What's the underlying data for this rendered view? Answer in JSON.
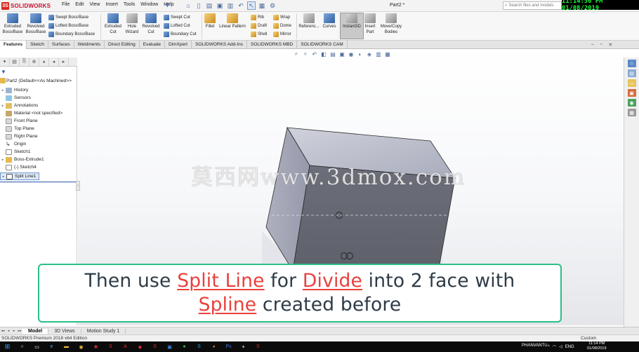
{
  "app": {
    "logo_text": "SOLIDWORKS",
    "document_title": "Part2 *",
    "search_placeholder": "Search files and models",
    "recording_clock": "11:14:56 PM 01/08/2019"
  },
  "menu": [
    "File",
    "Edit",
    "View",
    "Insert",
    "Tools",
    "Window",
    "Help"
  ],
  "quick_access": [
    "home-icon",
    "new-icon",
    "open-icon",
    "save-icon",
    "print-icon",
    "undo-icon",
    "select-icon",
    "rebuild-icon",
    "options-icon"
  ],
  "command_manager": {
    "extruded_boss": "Extruded Boss/Base",
    "revolved_boss": "Revolved Boss/Base",
    "swept_boss": "Swept Boss/Base",
    "lofted_boss": "Lofted Boss/Base",
    "boundary_boss": "Boundary Boss/Base",
    "extruded_cut": "Extruded Cut",
    "hole_wizard": "Hole Wizard",
    "revolved_cut": "Revolved Cut",
    "swept_cut": "Swept Cut",
    "lofted_cut": "Lofted Cut",
    "boundary_cut": "Boundary Cut",
    "fillet": "Fillet",
    "linear_pattern": "Linear Pattern",
    "rib": "Rib",
    "draft": "Draft",
    "shell": "Shell",
    "wrap": "Wrap",
    "dome": "Dome",
    "mirror": "Mirror",
    "reference_geometry": "Referenc...",
    "curves": "Curves",
    "instant3d": "Instant3D",
    "insert_part": "Insert Part",
    "move_copy_bodies": "Move/Copy Bodies"
  },
  "tabs": [
    "Features",
    "Sketch",
    "Surfaces",
    "Weldments",
    "Direct Editing",
    "Evaluate",
    "DimXpert",
    "SOLIDWORKS Add-Ins",
    "SOLIDWORKS MBD",
    "SOLIDWORKS CAM"
  ],
  "active_tab": "Features",
  "feature_tree": {
    "root": "Part2  (Default<<As Machined>>",
    "items": [
      {
        "label": "History",
        "icon": "history-icon",
        "expandable": true
      },
      {
        "label": "Sensors",
        "icon": "sensors-icon",
        "expandable": false
      },
      {
        "label": "Annotations",
        "icon": "annotations-icon",
        "expandable": true
      },
      {
        "label": "Material <not specified>",
        "icon": "material-icon",
        "expandable": false
      },
      {
        "label": "Front Plane",
        "icon": "plane-icon",
        "expandable": false
      },
      {
        "label": "Top Plane",
        "icon": "plane-icon",
        "expandable": false
      },
      {
        "label": "Right Plane",
        "icon": "plane-icon",
        "expandable": false
      },
      {
        "label": "Origin",
        "icon": "origin-icon",
        "expandable": false
      },
      {
        "label": "Sketch1",
        "icon": "sketch-icon",
        "expandable": false
      },
      {
        "label": "Boss-Extrude1",
        "icon": "extrude-icon",
        "expandable": true
      },
      {
        "label": "(-) Sketch4",
        "icon": "sketch-icon",
        "expandable": false
      },
      {
        "label": "Split Line1",
        "icon": "split-line-icon",
        "expandable": true,
        "selected": true
      }
    ]
  },
  "watermark": "莫西网www.3dmox.com",
  "caption": {
    "line1_a": "Then use ",
    "line1_hl1": "Split Line",
    "line1_b": " for ",
    "line1_hl2": "Divide",
    "line1_c": " into 2 face with",
    "line2_hl": "Spline",
    "line2_a": " created before",
    "highlight_color": "#e8403d",
    "border_color": "#2bbf86"
  },
  "bottom_tabs": [
    "Model",
    "3D Views",
    "Motion Study 1"
  ],
  "active_bottom_tab": "Model",
  "status": {
    "left": "SOLIDWORKS Premium 2018 x64 Edition",
    "right": "Custom"
  },
  "taskbar": {
    "user": "PHANVANTU",
    "lang": "ENG",
    "time": "11:14 PM",
    "date": "01/08/2019"
  },
  "colors": {
    "accent": "#2a5fae",
    "clock_green": "#1aff38",
    "model_face_top": "#b9bcc8",
    "model_face_front": "#6f717c"
  }
}
